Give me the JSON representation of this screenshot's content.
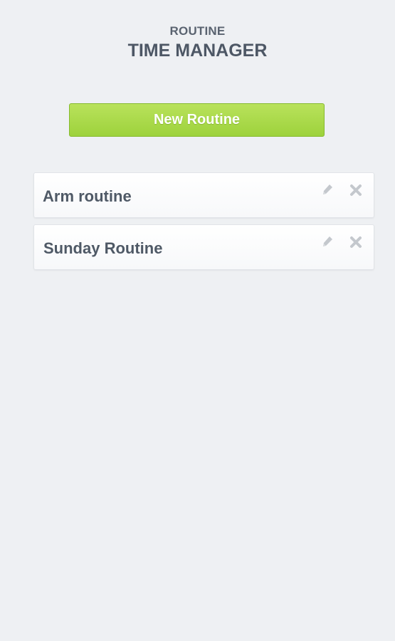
{
  "header": {
    "subtitle": "ROUTINE",
    "title": "TIME MANAGER"
  },
  "actions": {
    "new_routine_label": "New Routine"
  },
  "routines": [
    {
      "name": "Arm routine",
      "edit_icon": "pencil-icon",
      "delete_icon": "close-icon"
    },
    {
      "name": "Sunday Routine",
      "edit_icon": "pencil-icon",
      "delete_icon": "close-icon"
    }
  ],
  "colors": {
    "background": "#eef0f3",
    "accent_green": "#a6d845",
    "text": "#4f5966",
    "icon": "#c4c8cd"
  }
}
